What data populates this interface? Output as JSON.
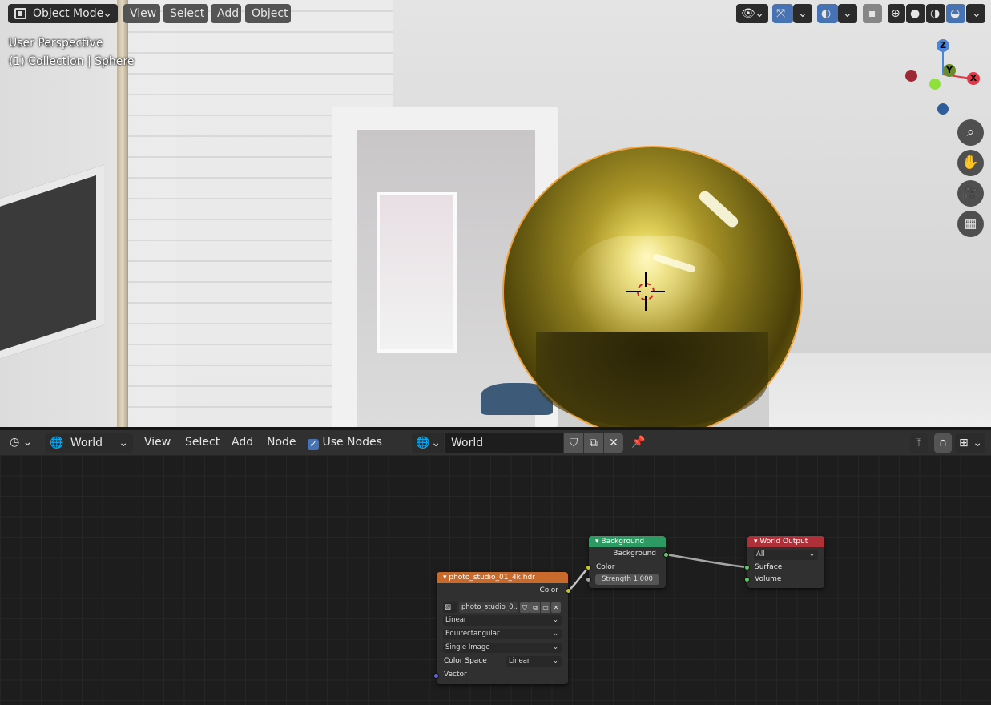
{
  "viewport": {
    "mode_label": "Object Mode",
    "menu": [
      "View",
      "Select",
      "Add",
      "Object"
    ],
    "overlay_line1": "User Perspective",
    "overlay_line2": "(1) Collection | Sphere",
    "gizmo": {
      "z": "Z",
      "y": "Y",
      "x": "X"
    },
    "colors": {
      "x": "#e53647",
      "y": "#8fc43a",
      "z": "#4b86d8",
      "selection": "#f0a23c"
    }
  },
  "node_editor": {
    "world_selector": "World",
    "menu": [
      "View",
      "Select",
      "Add",
      "Node"
    ],
    "use_nodes_label": "Use Nodes",
    "use_nodes_checked": true,
    "datablock_name": "World",
    "nodes": {
      "image": {
        "title": "photo_studio_01_4k.hdr",
        "output": "Color",
        "file_label": "photo_studio_0...",
        "interpolation": "Linear",
        "projection": "Equirectangular",
        "source": "Single Image",
        "color_space_label": "Color Space",
        "color_space": "Linear",
        "input": "Vector"
      },
      "background": {
        "title": "Background",
        "output": "Background",
        "input_color": "Color",
        "strength_label": "Strength",
        "strength_value": "1.000"
      },
      "output": {
        "title": "World Output",
        "target": "All",
        "surface": "Surface",
        "volume": "Volume"
      }
    },
    "header_colors": {
      "image": "#c86a2c",
      "background": "#2e9a63",
      "output": "#b0303a"
    }
  }
}
